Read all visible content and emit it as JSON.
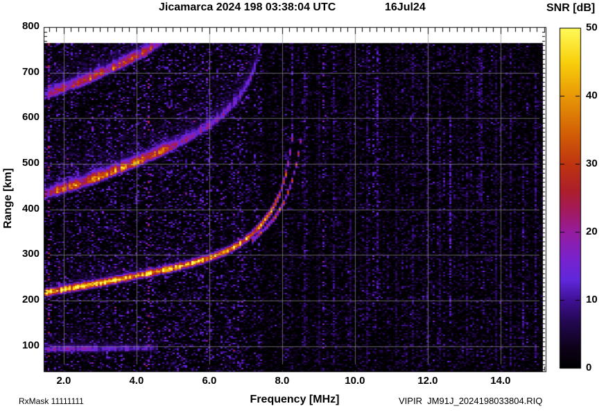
{
  "header": {
    "title": "Jicamarca 2024 198 03:38:04 UTC",
    "date": "16Jul24"
  },
  "footer": {
    "left": "RxMask 11111111",
    "right": "VIPIR  JM91J_2024198033804.RIQ"
  },
  "chart_data": {
    "type": "heatmap",
    "title": "Jicamarca 2024 198 03:38:04 UTC",
    "subtitle": "16Jul24",
    "xlabel": "Frequency [MHz]",
    "ylabel": "Range [km]",
    "grid": true,
    "x_axis": {
      "min": 1.45,
      "max": 15.24,
      "minor_step": 0.2,
      "major_ticks": [
        2,
        4,
        6,
        8,
        10,
        12,
        14
      ],
      "tick_labels": [
        "2.0",
        "4.0",
        "6.0",
        "8.0",
        "10.0",
        "12.0",
        "14.0"
      ]
    },
    "y_axis": {
      "min": 45,
      "max": 800,
      "data_max": 765,
      "minor_step": 10,
      "major_ticks": [
        100,
        200,
        300,
        400,
        500,
        600,
        700,
        800
      ],
      "tick_labels": [
        "100",
        "200",
        "300",
        "400",
        "500",
        "600",
        "700",
        "800"
      ]
    },
    "colorbar": {
      "label": "SNR [dB]",
      "min": 0,
      "max": 50,
      "ticks": [
        0,
        10,
        20,
        30,
        40,
        50
      ],
      "tick_labels": [
        "0",
        "10",
        "20",
        "30",
        "40",
        "50"
      ]
    },
    "palette": [
      [
        0.0,
        0,
        0,
        0
      ],
      [
        0.06,
        14,
        2,
        26
      ],
      [
        0.14,
        36,
        8,
        84
      ],
      [
        0.2,
        64,
        16,
        148
      ],
      [
        0.26,
        96,
        40,
        220
      ],
      [
        0.32,
        120,
        34,
        206
      ],
      [
        0.4,
        150,
        28,
        158
      ],
      [
        0.46,
        162,
        26,
        96
      ],
      [
        0.52,
        172,
        30,
        44
      ],
      [
        0.6,
        190,
        52,
        16
      ],
      [
        0.7,
        212,
        100,
        6
      ],
      [
        0.8,
        232,
        152,
        6
      ],
      [
        0.9,
        248,
        208,
        12
      ],
      [
        1.0,
        255,
        250,
        90
      ]
    ],
    "traces": [
      {
        "name": "F-layer first hop O-mode",
        "points": [
          [
            1.45,
            216
          ],
          [
            2,
            224
          ],
          [
            2.5,
            231
          ],
          [
            3,
            238
          ],
          [
            3.5,
            246
          ],
          [
            4,
            254
          ],
          [
            4.5,
            262
          ],
          [
            5,
            271
          ],
          [
            5.5,
            281
          ],
          [
            6,
            293
          ],
          [
            6.4,
            305
          ],
          [
            6.8,
            322
          ],
          [
            7.1,
            340
          ],
          [
            7.4,
            363
          ],
          [
            7.7,
            395
          ],
          [
            7.95,
            435
          ],
          [
            8.1,
            475
          ],
          [
            8.2,
            515
          ],
          [
            8.28,
            555
          ],
          [
            8.32,
            585
          ]
        ],
        "snr": [
          [
            1.45,
            46
          ],
          [
            2,
            47
          ],
          [
            3,
            46
          ],
          [
            4,
            44
          ],
          [
            5,
            42
          ],
          [
            6,
            40
          ],
          [
            6.8,
            37
          ],
          [
            7.4,
            34
          ],
          [
            7.9,
            31
          ],
          [
            8.32,
            26
          ]
        ],
        "sigma_dn": 5,
        "sigma_up": 6,
        "halo": {
          "km": 60,
          "tau": 22,
          "snr": [
            [
              1.45,
              15
            ],
            [
              4,
              13
            ],
            [
              6,
              9
            ],
            [
              7,
              5
            ],
            [
              8.32,
              0
            ]
          ]
        }
      },
      {
        "name": "F-layer first hop X-mode",
        "points": [
          [
            7.15,
            330
          ],
          [
            7.5,
            355
          ],
          [
            7.8,
            382
          ],
          [
            8.05,
            415
          ],
          [
            8.25,
            455
          ],
          [
            8.4,
            500
          ],
          [
            8.5,
            545
          ],
          [
            8.56,
            585
          ]
        ],
        "snr": [
          [
            7.15,
            20
          ],
          [
            7.8,
            26
          ],
          [
            8.2,
            28
          ],
          [
            8.56,
            24
          ]
        ],
        "sigma_dn": 4,
        "sigma_up": 4,
        "halo": null
      },
      {
        "name": "F-layer second hop",
        "points": [
          [
            1.45,
            430
          ],
          [
            2,
            444
          ],
          [
            2.5,
            456
          ],
          [
            3,
            470
          ],
          [
            3.5,
            486
          ],
          [
            4,
            502
          ],
          [
            4.5,
            519
          ],
          [
            5,
            537
          ],
          [
            5.5,
            558
          ],
          [
            6,
            583
          ],
          [
            6.4,
            608
          ],
          [
            6.8,
            642
          ],
          [
            7.1,
            680
          ],
          [
            7.3,
            722
          ],
          [
            7.4,
            760
          ]
        ],
        "snr": [
          [
            1.45,
            24
          ],
          [
            2,
            30
          ],
          [
            2.5,
            33
          ],
          [
            3,
            34
          ],
          [
            3.8,
            33
          ],
          [
            4.5,
            30
          ],
          [
            5,
            25
          ],
          [
            5.5,
            20
          ],
          [
            6,
            17
          ],
          [
            6.6,
            15
          ],
          [
            7.4,
            13
          ]
        ],
        "sigma_dn": 6,
        "sigma_up": 12,
        "halo": {
          "km": 125,
          "tau": 48,
          "snr": [
            [
              1.45,
              14
            ],
            [
              3,
              14
            ],
            [
              5,
              12
            ],
            [
              6.5,
              9
            ],
            [
              7.4,
              6
            ]
          ]
        }
      },
      {
        "name": "F-layer third hop",
        "points": [
          [
            1.45,
            648
          ],
          [
            2,
            664
          ],
          [
            2.5,
            678
          ],
          [
            3,
            696
          ],
          [
            3.5,
            714
          ],
          [
            4,
            734
          ],
          [
            4.4,
            752
          ],
          [
            4.7,
            766
          ]
        ],
        "snr": [
          [
            1.45,
            18
          ],
          [
            2.2,
            24
          ],
          [
            2.8,
            27
          ],
          [
            3.5,
            27
          ],
          [
            4,
            25
          ],
          [
            4.7,
            22
          ]
        ],
        "sigma_dn": 6,
        "sigma_up": 12,
        "halo": {
          "km": 90,
          "tau": 40,
          "snr": [
            [
              1.45,
              13
            ],
            [
              3,
              12
            ],
            [
              4.7,
              10
            ]
          ]
        }
      },
      {
        "name": "E-region echo",
        "points": [
          [
            1.45,
            92
          ],
          [
            3,
            93
          ],
          [
            4.6,
            95
          ]
        ],
        "snr": [
          [
            1.45,
            16
          ],
          [
            2.5,
            15
          ],
          [
            3.5,
            13
          ],
          [
            4.6,
            10
          ]
        ],
        "sigma_dn": 4,
        "sigma_up": 8,
        "halo": {
          "km": 55,
          "tau": 25,
          "snr": [
            [
              1.45,
              10
            ],
            [
              2.5,
              9
            ],
            [
              4.6,
              5
            ]
          ]
        }
      }
    ],
    "rfi_streaks": [
      [
        8.27,
        13,
        560,
        765
      ],
      [
        8.62,
        9,
        60,
        760
      ],
      [
        9.0,
        8,
        60,
        760
      ],
      [
        9.42,
        10,
        60,
        760
      ],
      [
        9.86,
        8,
        60,
        760
      ],
      [
        10.33,
        9,
        60,
        760
      ],
      [
        10.62,
        12,
        200,
        760
      ],
      [
        11.15,
        8,
        60,
        760
      ],
      [
        11.58,
        9,
        60,
        760
      ],
      [
        12.0,
        10,
        60,
        760
      ],
      [
        12.35,
        9,
        60,
        760
      ],
      [
        12.62,
        13,
        150,
        600
      ],
      [
        13.08,
        9,
        60,
        760
      ],
      [
        13.45,
        10,
        400,
        760
      ],
      [
        13.9,
        8,
        60,
        760
      ],
      [
        14.3,
        9,
        60,
        760
      ],
      [
        14.63,
        12,
        100,
        500
      ],
      [
        14.95,
        10,
        60,
        700
      ]
    ],
    "noise": {
      "left_fmax": 7.45,
      "left_boost": 1.5,
      "speckle_prob": 0.05
    }
  }
}
